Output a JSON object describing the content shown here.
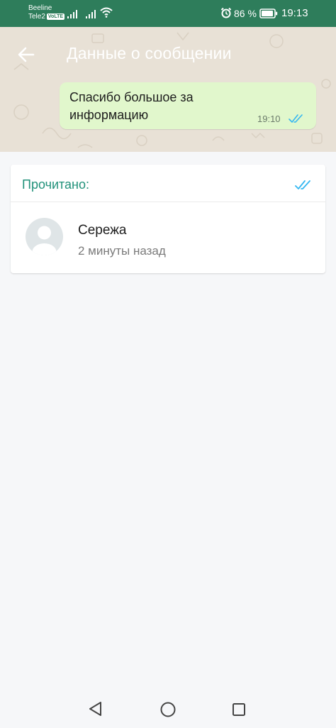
{
  "status_bar": {
    "carrier1": "Beeline",
    "carrier2": "Tele2",
    "volte": "VoLTE",
    "battery": "86 %",
    "time": "19:13"
  },
  "header": {
    "title": "Данные о сообщении"
  },
  "message": {
    "text": "Спасибо большое за информацию",
    "time": "19:10"
  },
  "read_section": {
    "label": "Прочитано:",
    "contact_name": "Сережа",
    "read_time": "2 минуты назад"
  },
  "colors": {
    "status_bar": "#2e7d5b",
    "accent": "#21917a",
    "bubble": "#e1f7cc",
    "read_ticks": "#34b7f1"
  },
  "icons": {
    "back": "arrow-left-icon",
    "read_receipt": "double-check-icon",
    "avatar": "default-avatar-icon"
  }
}
